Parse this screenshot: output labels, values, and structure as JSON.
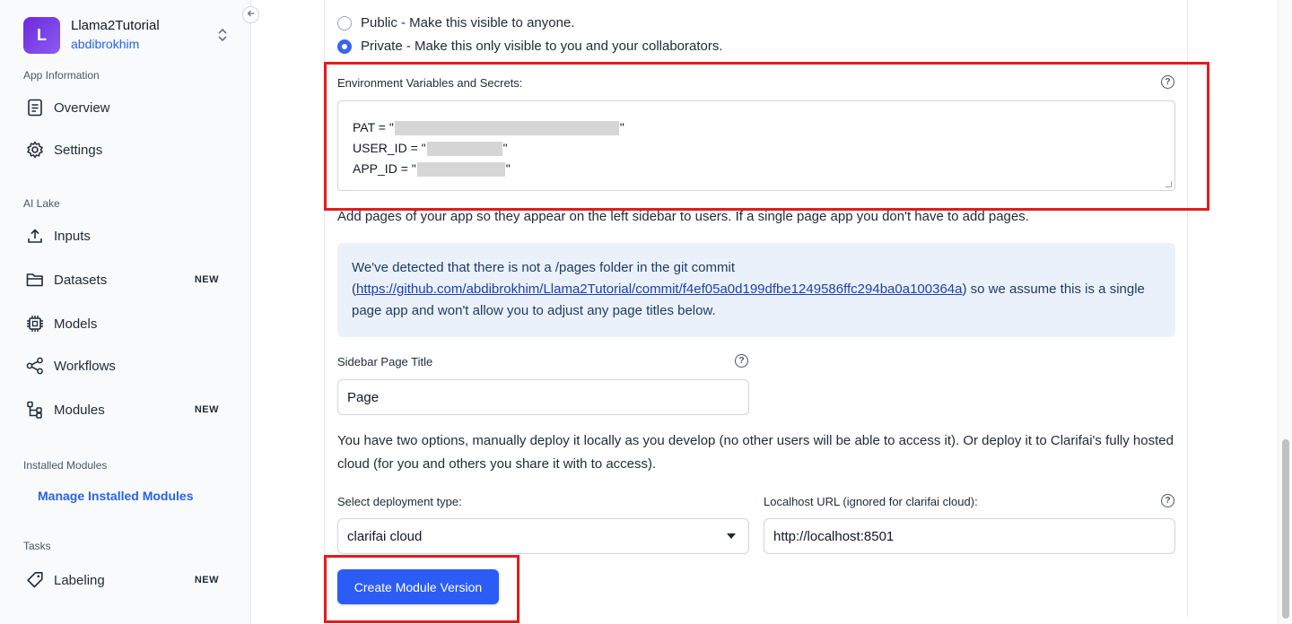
{
  "app": {
    "logo_letter": "L",
    "name": "Llama2Tutorial",
    "owner": "abdibrokhim",
    "switch_icon": "chevron-up-down-icon",
    "collapse_icon": "arrow-left-icon"
  },
  "sidebar": {
    "sections": {
      "app_information": "App Information",
      "ai_lake": "AI Lake",
      "installed_modules": "Installed Modules",
      "tasks": "Tasks"
    },
    "items": [
      {
        "label": "Overview",
        "icon": "document-icon",
        "badge": ""
      },
      {
        "label": "Settings",
        "icon": "gear-icon",
        "badge": ""
      },
      {
        "label": "Inputs",
        "icon": "upload-icon",
        "badge": ""
      },
      {
        "label": "Datasets",
        "icon": "folder-icon",
        "badge": "NEW"
      },
      {
        "label": "Models",
        "icon": "chip-icon",
        "badge": ""
      },
      {
        "label": "Workflows",
        "icon": "share-icon",
        "badge": ""
      },
      {
        "label": "Modules",
        "icon": "tree-icon",
        "badge": "NEW"
      },
      {
        "label": "Labeling",
        "icon": "tag-icon",
        "badge": "NEW"
      }
    ],
    "manage_link": "Manage Installed Modules"
  },
  "visibility": {
    "public_label": "Public - Make this visible to anyone.",
    "private_label": "Private - Make this only visible to you and your collaborators.",
    "selected": "private"
  },
  "env": {
    "label": "Environment Variables and Secrets:",
    "lines": [
      {
        "key": "PAT = \"",
        "suffix": "\""
      },
      {
        "key": "USER_ID = \"",
        "suffix": "\""
      },
      {
        "key": "APP_ID = \"",
        "suffix": "\""
      }
    ]
  },
  "pages": {
    "description": "Add pages of your app so they appear on the left sidebar to users. If a single page app you don't have to add pages.",
    "info_prefix": "We've detected that there is not a /pages folder in the git commit (",
    "info_link": "https://github.com/abdibrokhim/Llama2Tutorial/commit/f4ef05a0d199dfbe1249586ffc294ba0a100364a",
    "info_suffix": ") so we assume this is a single page app and won't allow you to adjust any page titles below.",
    "sidebar_title_label": "Sidebar Page Title",
    "sidebar_title_value": "Page"
  },
  "deploy": {
    "description": "You have two options, manually deploy it locally as you develop (no other users will be able to access it). Or deploy it to Clarifai's fully hosted cloud (for you and others you share it with to access).",
    "type_label": "Select deployment type:",
    "type_value": "clarifai cloud",
    "url_label": "Localhost URL (ignored for clarifai cloud):",
    "url_value": "http://localhost:8501",
    "submit_label": "Create Module Version"
  },
  "colors": {
    "accent": "#2b5cf5",
    "highlight": "#e11d1d",
    "info_bg": "#eaf1fb"
  }
}
